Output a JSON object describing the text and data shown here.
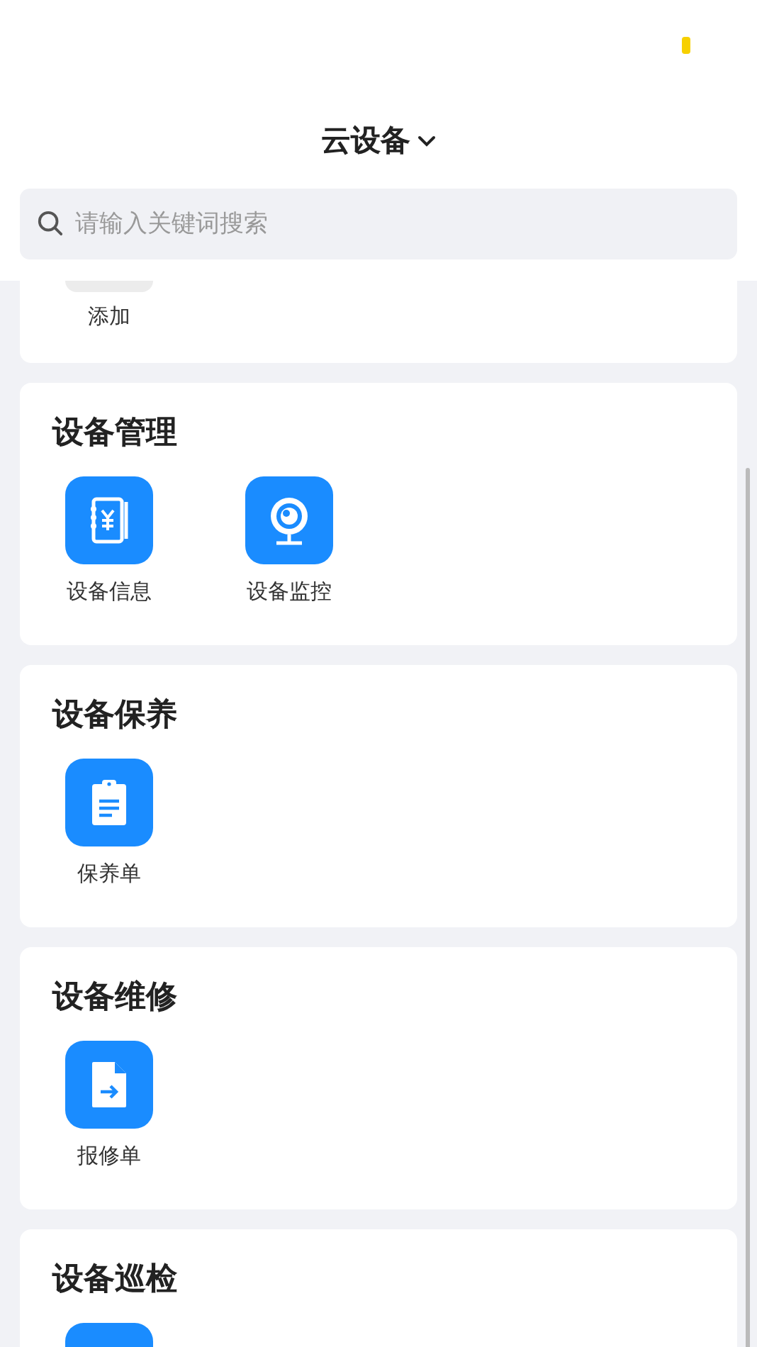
{
  "header": {
    "title": "云设备"
  },
  "search": {
    "placeholder": "请输入关键词搜索"
  },
  "sections": [
    {
      "items": [
        {
          "kind": "add",
          "label": "添加"
        }
      ]
    },
    {
      "title": "设备管理",
      "items": [
        {
          "kind": "ledger",
          "label": "设备信息"
        },
        {
          "kind": "camera",
          "label": "设备监控"
        }
      ]
    },
    {
      "title": "设备保养",
      "items": [
        {
          "kind": "clipboard",
          "label": "保养单"
        }
      ]
    },
    {
      "title": "设备维修",
      "items": [
        {
          "kind": "document",
          "label": "报修单"
        }
      ]
    },
    {
      "title": "设备巡检",
      "items": [
        {
          "kind": "plain"
        }
      ]
    }
  ]
}
